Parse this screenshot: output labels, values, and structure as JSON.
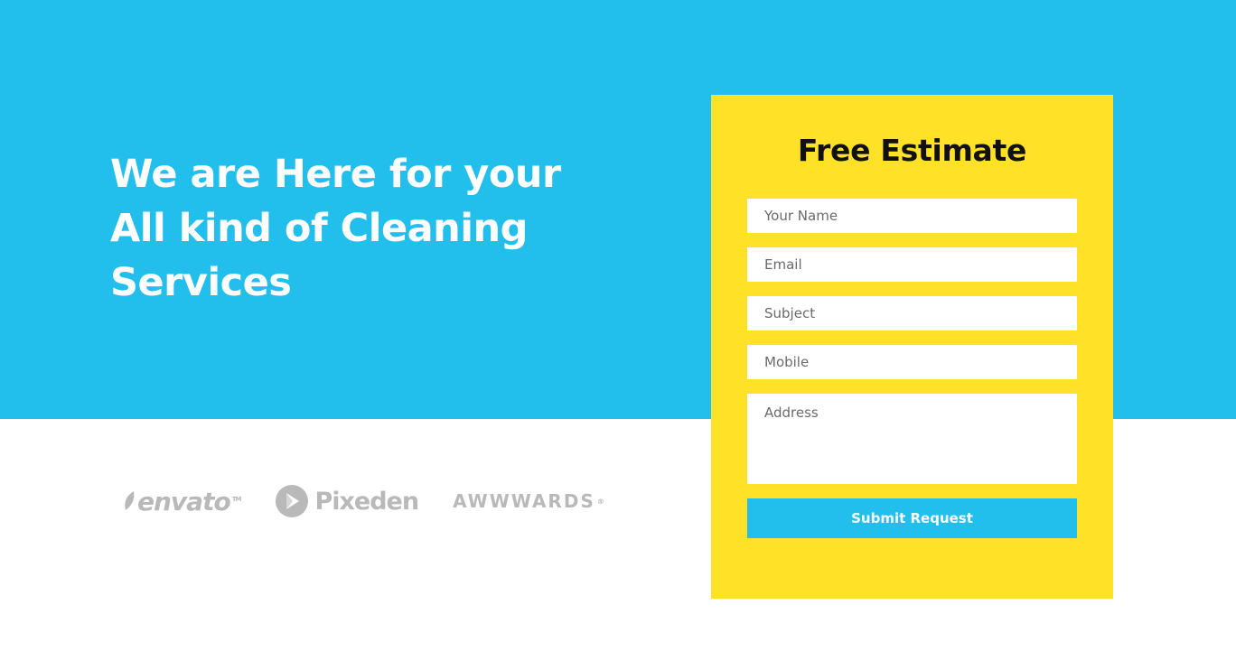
{
  "hero": {
    "title_line1": "We are Here for your",
    "title_line2": "All kind of Cleaning",
    "title_line3": "Services"
  },
  "logos": [
    {
      "name": "envato",
      "tm": "TM",
      "icon": "envato-leaf-icon"
    },
    {
      "name": "Pixeden",
      "icon": "pixeden-circle-icon"
    },
    {
      "name": "AWWWARDS",
      "mark": "®"
    }
  ],
  "form": {
    "title": "Free Estimate",
    "name_placeholder": "Your Name",
    "email_placeholder": "Email",
    "subject_placeholder": "Subject",
    "mobile_placeholder": "Mobile",
    "address_placeholder": "Address",
    "submit_label": "Submit Request"
  },
  "colors": {
    "hero_bg": "#22bfec",
    "form_bg": "#ffe227",
    "button_bg": "#22bfec",
    "logo_gray": "#b9b9b9"
  }
}
